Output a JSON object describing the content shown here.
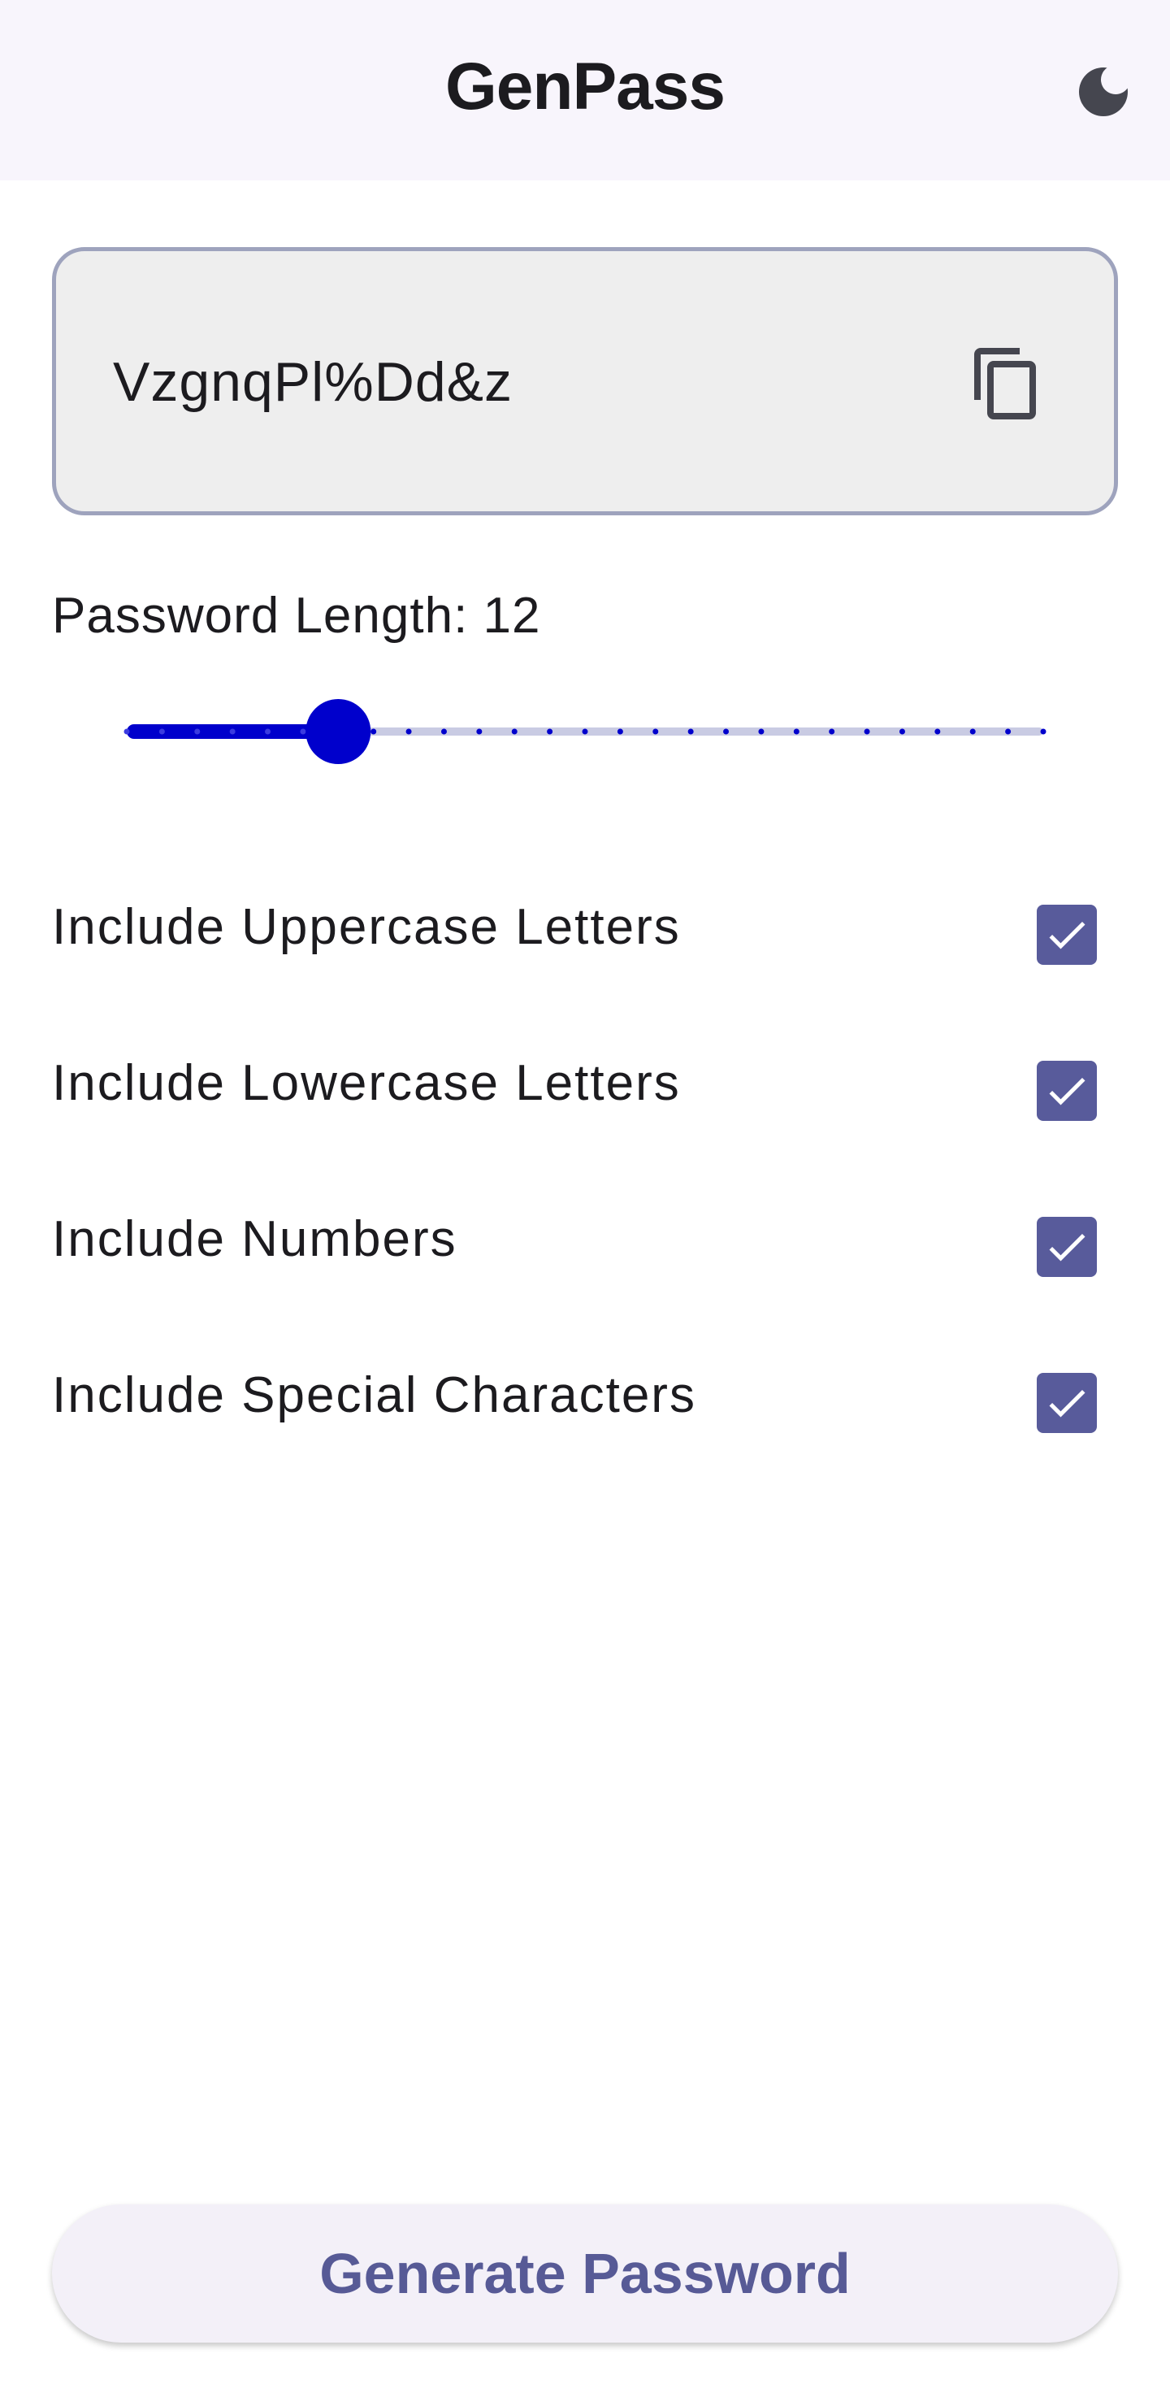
{
  "app": {
    "title": "GenPass"
  },
  "topbar": {
    "theme_icon": "moon-icon"
  },
  "password": {
    "value": "VzgnqPl%Dd&z",
    "copy_icon": "copy-icon"
  },
  "length": {
    "label": "Password Length: 12",
    "value": 12,
    "min": 6,
    "max": 32
  },
  "options": [
    {
      "label": "Include Uppercase Letters",
      "checked": true
    },
    {
      "label": "Include Lowercase Letters",
      "checked": true
    },
    {
      "label": "Include Numbers",
      "checked": true
    },
    {
      "label": "Include Special Characters",
      "checked": true
    }
  ],
  "actions": {
    "generate_label": "Generate Password"
  },
  "colors": {
    "accent": "#0000cc",
    "checkbox": "#585b9b",
    "button_text": "#575a96",
    "topbar_bg": "#f8f5fc"
  }
}
